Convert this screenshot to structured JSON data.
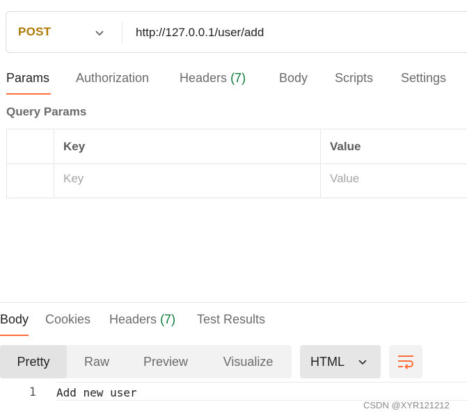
{
  "request": {
    "method": "POST",
    "url": "http://127.0.0.1/user/add"
  },
  "request_tabs": [
    {
      "label": "Params",
      "active": true
    },
    {
      "label": "Authorization"
    },
    {
      "label": "Headers",
      "count": "(7)"
    },
    {
      "label": "Body"
    },
    {
      "label": "Scripts"
    },
    {
      "label": "Settings"
    }
  ],
  "query_params": {
    "title": "Query Params",
    "columns": [
      "Key",
      "Value"
    ],
    "placeholders": [
      "Key",
      "Value"
    ]
  },
  "response_tabs": [
    {
      "label": "Body",
      "active": true
    },
    {
      "label": "Cookies"
    },
    {
      "label": "Headers",
      "count": "(7)"
    },
    {
      "label": "Test Results"
    }
  ],
  "view_modes": [
    {
      "label": "Pretty",
      "active": true
    },
    {
      "label": "Raw"
    },
    {
      "label": "Preview"
    },
    {
      "label": "Visualize"
    }
  ],
  "format_select": "HTML",
  "response_body": {
    "lines": [
      {
        "number": "1",
        "text": "Add new user"
      }
    ]
  },
  "watermark": "CSDN @XYR121212",
  "colors": {
    "accent": "#ff6c37",
    "method_post": "#ad7a03",
    "count_green": "#0c7b3a"
  },
  "icons": {
    "method_dropdown": "chevron-down-icon",
    "format_dropdown": "chevron-down-icon",
    "wrap": "wrap-lines-icon"
  }
}
